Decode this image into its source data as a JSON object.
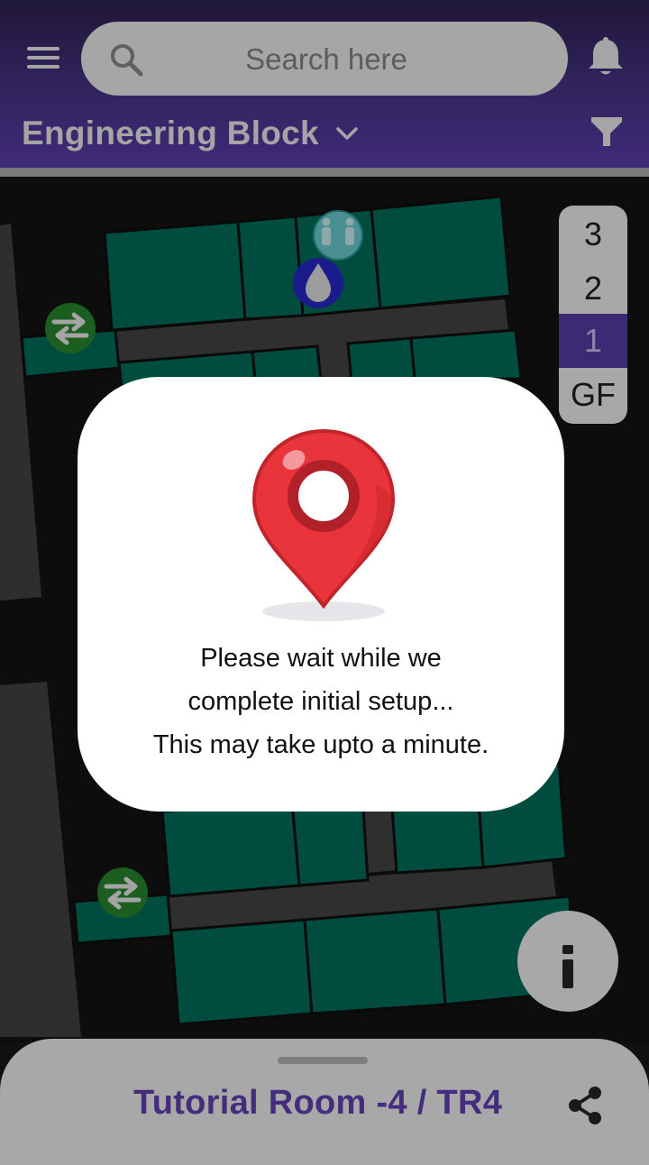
{
  "header": {
    "search_placeholder": "Search here",
    "block_name": "Engineering Block"
  },
  "icons": {
    "menu": "hamburger-menu-icon",
    "search": "magnifier-icon",
    "notifications": "bell-icon",
    "dropdown": "chevron-down-icon",
    "filter": "funnel-icon",
    "info": "info-icon",
    "share": "share-icon",
    "map_markers": [
      "restroom-icon",
      "water-drop-icon",
      "exchange-arrows-icon"
    ]
  },
  "floors": {
    "items": [
      "3",
      "2",
      "1",
      "GF"
    ],
    "selected": "1"
  },
  "modal": {
    "line1": "Please wait while we",
    "line2": "complete initial setup...",
    "line3": "This may take upto a minute."
  },
  "bottom_sheet": {
    "room_title": "Tutorial Room -4 / TR4"
  },
  "colors": {
    "header": "#3f2a78",
    "accent": "#432d7c",
    "room_fill": "#004d40",
    "pin_red": "#e8343a"
  }
}
